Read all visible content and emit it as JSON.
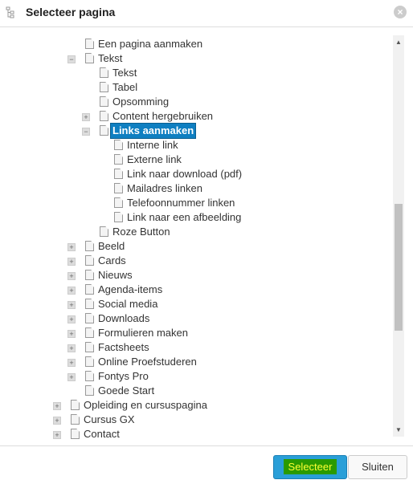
{
  "dialog": {
    "title": "Selecteer pagina",
    "select_label": "Selecteer",
    "close_label": "Sluiten",
    "accent": "#0f7fc1"
  },
  "tree": [
    {
      "label": "Een pagina aanmaken",
      "level": 1,
      "toggle": ""
    },
    {
      "label": "Tekst",
      "level": 1,
      "toggle": "−"
    },
    {
      "label": "Tekst",
      "level": 2,
      "toggle": ""
    },
    {
      "label": "Tabel",
      "level": 2,
      "toggle": ""
    },
    {
      "label": "Opsomming",
      "level": 2,
      "toggle": ""
    },
    {
      "label": "Content hergebruiken",
      "level": 2,
      "toggle": "+"
    },
    {
      "label": "Links aanmaken",
      "level": 2,
      "toggle": "−",
      "selected": true
    },
    {
      "label": "Interne link",
      "level": 3,
      "toggle": ""
    },
    {
      "label": "Externe link",
      "level": 3,
      "toggle": ""
    },
    {
      "label": "Link naar download (pdf)",
      "level": 3,
      "toggle": ""
    },
    {
      "label": "Mailadres linken",
      "level": 3,
      "toggle": ""
    },
    {
      "label": "Telefoonnummer linken",
      "level": 3,
      "toggle": ""
    },
    {
      "label": "Link naar een afbeelding",
      "level": 3,
      "toggle": ""
    },
    {
      "label": "Roze Button",
      "level": 2,
      "toggle": ""
    },
    {
      "label": "Beeld",
      "level": 1,
      "toggle": "+"
    },
    {
      "label": "Cards",
      "level": 1,
      "toggle": "+"
    },
    {
      "label": "Nieuws",
      "level": 1,
      "toggle": "+"
    },
    {
      "label": "Agenda-items",
      "level": 1,
      "toggle": "+"
    },
    {
      "label": "Social media",
      "level": 1,
      "toggle": "+"
    },
    {
      "label": "Downloads",
      "level": 1,
      "toggle": "+"
    },
    {
      "label": "Formulieren maken",
      "level": 1,
      "toggle": "+"
    },
    {
      "label": "Factsheets",
      "level": 1,
      "toggle": "+"
    },
    {
      "label": "Online Proefstuderen",
      "level": 1,
      "toggle": "+"
    },
    {
      "label": "Fontys Pro",
      "level": 1,
      "toggle": "+"
    },
    {
      "label": "Goede Start",
      "level": 1,
      "toggle": ""
    },
    {
      "label": "Opleiding en cursuspagina",
      "level": 0,
      "toggle": "+"
    },
    {
      "label": "Cursus GX",
      "level": 0,
      "toggle": "+"
    },
    {
      "label": "Contact",
      "level": 0,
      "toggle": "+"
    }
  ]
}
